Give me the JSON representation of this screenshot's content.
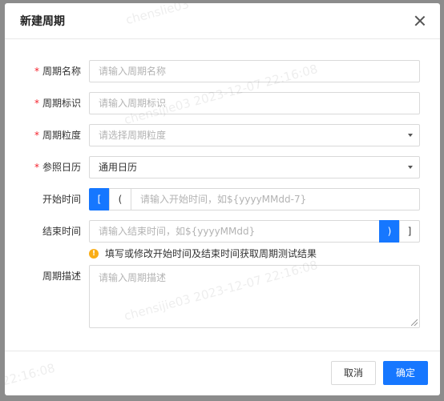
{
  "dialog": {
    "title": "新建周期",
    "close_icon": "close-icon"
  },
  "form": {
    "name": {
      "label": "周期名称",
      "required": "*",
      "placeholder": "请输入周期名称",
      "value": ""
    },
    "code": {
      "label": "周期标识",
      "required": "*",
      "placeholder": "请输入周期标识",
      "value": ""
    },
    "granularity": {
      "label": "周期粒度",
      "required": "*",
      "placeholder": "请选择周期粒度"
    },
    "calendar": {
      "label": "参照日历",
      "required": "*",
      "value": "通用日历"
    },
    "start": {
      "label": "开始时间",
      "bracket_closed": "[",
      "bracket_open": "(",
      "placeholder": "请输入开始时间，如${yyyyMMdd-7}"
    },
    "end": {
      "label": "结束时间",
      "placeholder": "请输入结束时间，如${yyyyMMdd}",
      "bracket_open": ")",
      "bracket_closed": "]"
    },
    "hint": "填写或修改开始时间及结束时间获取周期测试结果",
    "description": {
      "label": "周期描述",
      "placeholder": "请输入周期描述"
    }
  },
  "footer": {
    "cancel": "取消",
    "ok": "确定"
  },
  "watermark": {
    "user": "chenslie03",
    "timestamp": "chensijie03 2023-12-07 22:16:08",
    "time": "22:16:08"
  },
  "colors": {
    "primary": "#1677ff",
    "required": "#f5222d",
    "warning": "#faad14"
  }
}
